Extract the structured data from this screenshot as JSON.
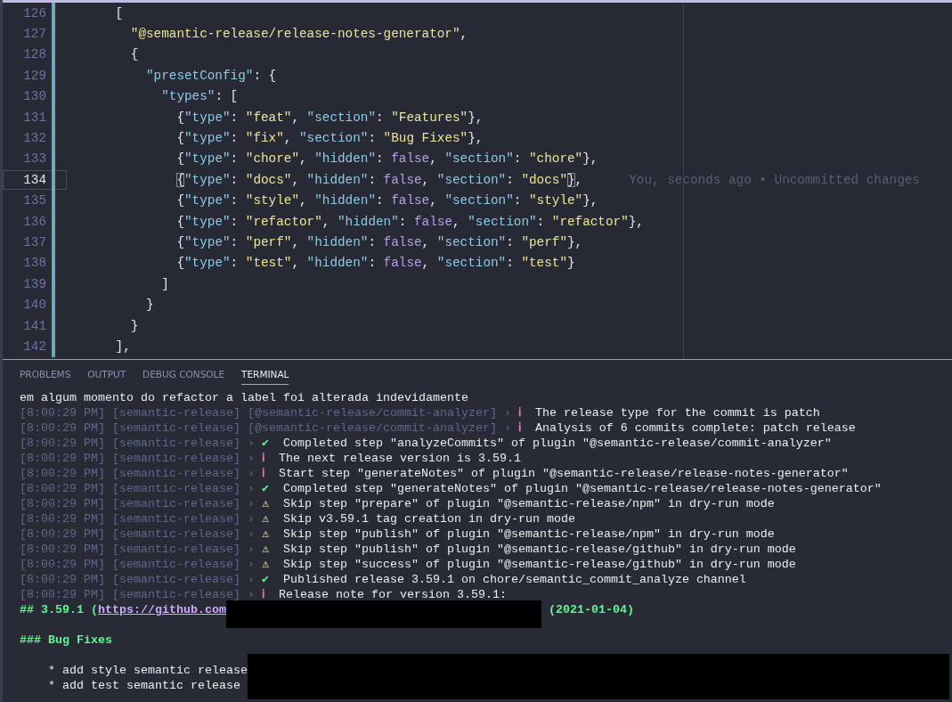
{
  "editor": {
    "lines": [
      {
        "number": "126",
        "modified": true,
        "current": false,
        "tokens": [
          {
            "kind": "punct",
            "text": "      ["
          }
        ]
      },
      {
        "number": "127",
        "modified": true,
        "current": false,
        "tokens": [
          {
            "kind": "str",
            "text": "        \"@semantic-release/release-notes-generator\""
          },
          {
            "kind": "punct",
            "text": ","
          }
        ]
      },
      {
        "number": "128",
        "modified": true,
        "current": false,
        "tokens": [
          {
            "kind": "punct",
            "text": "        {"
          }
        ]
      },
      {
        "number": "129",
        "modified": true,
        "current": false,
        "tokens": [
          {
            "kind": "key",
            "text": "          \"presetConfig\""
          },
          {
            "kind": "punct",
            "text": ": {"
          }
        ]
      },
      {
        "number": "130",
        "modified": true,
        "current": false,
        "tokens": [
          {
            "kind": "key",
            "text": "            \"types\""
          },
          {
            "kind": "punct",
            "text": ": ["
          }
        ]
      },
      {
        "number": "131",
        "modified": true,
        "current": false,
        "tokens": [
          {
            "kind": "punct",
            "text": "              {"
          },
          {
            "kind": "key",
            "text": "\"type\""
          },
          {
            "kind": "punct",
            "text": ": "
          },
          {
            "kind": "str",
            "text": "\"feat\""
          },
          {
            "kind": "punct",
            "text": ", "
          },
          {
            "kind": "key",
            "text": "\"section\""
          },
          {
            "kind": "punct",
            "text": ": "
          },
          {
            "kind": "str",
            "text": "\"Features\""
          },
          {
            "kind": "punct",
            "text": "},"
          }
        ]
      },
      {
        "number": "132",
        "modified": true,
        "current": false,
        "tokens": [
          {
            "kind": "punct",
            "text": "              {"
          },
          {
            "kind": "key",
            "text": "\"type\""
          },
          {
            "kind": "punct",
            "text": ": "
          },
          {
            "kind": "str",
            "text": "\"fix\""
          },
          {
            "kind": "punct",
            "text": ", "
          },
          {
            "kind": "key",
            "text": "\"section\""
          },
          {
            "kind": "punct",
            "text": ": "
          },
          {
            "kind": "str",
            "text": "\"Bug Fixes\""
          },
          {
            "kind": "punct",
            "text": "},"
          }
        ]
      },
      {
        "number": "133",
        "modified": true,
        "current": false,
        "tokens": [
          {
            "kind": "punct",
            "text": "              {"
          },
          {
            "kind": "key",
            "text": "\"type\""
          },
          {
            "kind": "punct",
            "text": ": "
          },
          {
            "kind": "str",
            "text": "\"chore\""
          },
          {
            "kind": "punct",
            "text": ", "
          },
          {
            "kind": "key",
            "text": "\"hidden\""
          },
          {
            "kind": "punct",
            "text": ": "
          },
          {
            "kind": "bool",
            "text": "false"
          },
          {
            "kind": "punct",
            "text": ", "
          },
          {
            "kind": "key",
            "text": "\"section\""
          },
          {
            "kind": "punct",
            "text": ": "
          },
          {
            "kind": "str",
            "text": "\"chore\""
          },
          {
            "kind": "punct",
            "text": "},"
          }
        ]
      },
      {
        "number": "134",
        "modified": true,
        "current": true,
        "annotation": "You, seconds ago • Uncommitted changes",
        "tokens": [
          {
            "kind": "bracket",
            "text": "              {"
          },
          {
            "kind": "key",
            "text": "\"type\""
          },
          {
            "kind": "punct",
            "text": ": "
          },
          {
            "kind": "str",
            "text": "\"docs\""
          },
          {
            "kind": "punct",
            "text": ", "
          },
          {
            "kind": "key",
            "text": "\"hidden\""
          },
          {
            "kind": "punct",
            "text": ": "
          },
          {
            "kind": "bool",
            "text": "false"
          },
          {
            "kind": "punct",
            "text": ", "
          },
          {
            "kind": "key",
            "text": "\"section\""
          },
          {
            "kind": "punct",
            "text": ": "
          },
          {
            "kind": "str",
            "text": "\"docs\""
          },
          {
            "kind": "bracket",
            "text": "}"
          },
          {
            "kind": "punct",
            "text": ","
          }
        ]
      },
      {
        "number": "135",
        "modified": true,
        "current": false,
        "tokens": [
          {
            "kind": "punct",
            "text": "              {"
          },
          {
            "kind": "key",
            "text": "\"type\""
          },
          {
            "kind": "punct",
            "text": ": "
          },
          {
            "kind": "str",
            "text": "\"style\""
          },
          {
            "kind": "punct",
            "text": ", "
          },
          {
            "kind": "key",
            "text": "\"hidden\""
          },
          {
            "kind": "punct",
            "text": ": "
          },
          {
            "kind": "bool",
            "text": "false"
          },
          {
            "kind": "punct",
            "text": ", "
          },
          {
            "kind": "key",
            "text": "\"section\""
          },
          {
            "kind": "punct",
            "text": ": "
          },
          {
            "kind": "str",
            "text": "\"style\""
          },
          {
            "kind": "punct",
            "text": "},"
          }
        ]
      },
      {
        "number": "136",
        "modified": true,
        "current": false,
        "tokens": [
          {
            "kind": "punct",
            "text": "              {"
          },
          {
            "kind": "key",
            "text": "\"type\""
          },
          {
            "kind": "punct",
            "text": ": "
          },
          {
            "kind": "str",
            "text": "\"refactor\""
          },
          {
            "kind": "punct",
            "text": ", "
          },
          {
            "kind": "key",
            "text": "\"hidden\""
          },
          {
            "kind": "punct",
            "text": ": "
          },
          {
            "kind": "bool",
            "text": "false"
          },
          {
            "kind": "punct",
            "text": ", "
          },
          {
            "kind": "key",
            "text": "\"section\""
          },
          {
            "kind": "punct",
            "text": ": "
          },
          {
            "kind": "str",
            "text": "\"refactor\""
          },
          {
            "kind": "punct",
            "text": "},"
          }
        ]
      },
      {
        "number": "137",
        "modified": true,
        "current": false,
        "tokens": [
          {
            "kind": "punct",
            "text": "              {"
          },
          {
            "kind": "key",
            "text": "\"type\""
          },
          {
            "kind": "punct",
            "text": ": "
          },
          {
            "kind": "str",
            "text": "\"perf\""
          },
          {
            "kind": "punct",
            "text": ", "
          },
          {
            "kind": "key",
            "text": "\"hidden\""
          },
          {
            "kind": "punct",
            "text": ": "
          },
          {
            "kind": "bool",
            "text": "false"
          },
          {
            "kind": "punct",
            "text": ", "
          },
          {
            "kind": "key",
            "text": "\"section\""
          },
          {
            "kind": "punct",
            "text": ": "
          },
          {
            "kind": "str",
            "text": "\"perf\""
          },
          {
            "kind": "punct",
            "text": "},"
          }
        ]
      },
      {
        "number": "138",
        "modified": true,
        "current": false,
        "tokens": [
          {
            "kind": "punct",
            "text": "              {"
          },
          {
            "kind": "key",
            "text": "\"type\""
          },
          {
            "kind": "punct",
            "text": ": "
          },
          {
            "kind": "str",
            "text": "\"test\""
          },
          {
            "kind": "punct",
            "text": ", "
          },
          {
            "kind": "key",
            "text": "\"hidden\""
          },
          {
            "kind": "punct",
            "text": ": "
          },
          {
            "kind": "bool",
            "text": "false"
          },
          {
            "kind": "punct",
            "text": ", "
          },
          {
            "kind": "key",
            "text": "\"section\""
          },
          {
            "kind": "punct",
            "text": ": "
          },
          {
            "kind": "str",
            "text": "\"test\""
          },
          {
            "kind": "punct",
            "text": "}"
          }
        ]
      },
      {
        "number": "139",
        "modified": true,
        "current": false,
        "tokens": [
          {
            "kind": "punct",
            "text": "            ]"
          }
        ]
      },
      {
        "number": "140",
        "modified": true,
        "current": false,
        "tokens": [
          {
            "kind": "punct",
            "text": "          }"
          }
        ]
      },
      {
        "number": "141",
        "modified": true,
        "current": false,
        "tokens": [
          {
            "kind": "punct",
            "text": "        }"
          }
        ]
      },
      {
        "number": "142",
        "modified": true,
        "current": false,
        "tokens": [
          {
            "kind": "punct",
            "text": "      ],"
          }
        ]
      }
    ]
  },
  "panel": {
    "tabs": [
      {
        "label": "PROBLEMS",
        "selected": false
      },
      {
        "label": "OUTPUT",
        "selected": false
      },
      {
        "label": "DEBUG CONSOLE",
        "selected": false
      },
      {
        "label": "TERMINAL",
        "selected": true
      }
    ],
    "terminal": {
      "lines": [
        {
          "kind": "plain",
          "text": "em algum momento do refactor a label foi alterada indevidamente"
        },
        {
          "kind": "log",
          "time": "[8:00:29 PM]",
          "scope": "[semantic-release]",
          "plugin": "[@semantic-release/commit-analyzer]",
          "sep": "›",
          "icon": {
            "kind": "info",
            "glyph": "ℹ"
          },
          "message": "The release type for the commit is patch"
        },
        {
          "kind": "log",
          "time": "[8:00:29 PM]",
          "scope": "[semantic-release]",
          "plugin": "[@semantic-release/commit-analyzer]",
          "sep": "›",
          "icon": {
            "kind": "info",
            "glyph": "ℹ"
          },
          "message": "Analysis of 6 commits complete: patch release"
        },
        {
          "kind": "log",
          "time": "[8:00:29 PM]",
          "scope": "[semantic-release]",
          "sep": "›",
          "icon": {
            "kind": "success",
            "glyph": "✔"
          },
          "message": "Completed step \"analyzeCommits\" of plugin \"@semantic-release/commit-analyzer\""
        },
        {
          "kind": "log",
          "time": "[8:00:29 PM]",
          "scope": "[semantic-release]",
          "sep": "›",
          "icon": {
            "kind": "info",
            "glyph": "ℹ"
          },
          "message": "The next release version is 3.59.1"
        },
        {
          "kind": "log",
          "time": "[8:00:29 PM]",
          "scope": "[semantic-release]",
          "sep": "›",
          "icon": {
            "kind": "info",
            "glyph": "ℹ"
          },
          "message": "Start step \"generateNotes\" of plugin \"@semantic-release/release-notes-generator\""
        },
        {
          "kind": "log",
          "time": "[8:00:29 PM]",
          "scope": "[semantic-release]",
          "sep": "›",
          "icon": {
            "kind": "success",
            "glyph": "✔"
          },
          "message": "Completed step \"generateNotes\" of plugin \"@semantic-release/release-notes-generator\""
        },
        {
          "kind": "log",
          "time": "[8:00:29 PM]",
          "scope": "[semantic-release]",
          "sep": "›",
          "icon": {
            "kind": "warn",
            "glyph": "⚠"
          },
          "message": "Skip step \"prepare\" of plugin \"@semantic-release/npm\" in dry-run mode"
        },
        {
          "kind": "log",
          "time": "[8:00:29 PM]",
          "scope": "[semantic-release]",
          "sep": "›",
          "icon": {
            "kind": "warn",
            "glyph": "⚠"
          },
          "message": "Skip v3.59.1 tag creation in dry-run mode"
        },
        {
          "kind": "log",
          "time": "[8:00:29 PM]",
          "scope": "[semantic-release]",
          "sep": "›",
          "icon": {
            "kind": "warn",
            "glyph": "⚠"
          },
          "message": "Skip step \"publish\" of plugin \"@semantic-release/npm\" in dry-run mode"
        },
        {
          "kind": "log",
          "time": "[8:00:29 PM]",
          "scope": "[semantic-release]",
          "sep": "›",
          "icon": {
            "kind": "warn",
            "glyph": "⚠"
          },
          "message": "Skip step \"publish\" of plugin \"@semantic-release/github\" in dry-run mode"
        },
        {
          "kind": "log",
          "time": "[8:00:29 PM]",
          "scope": "[semantic-release]",
          "sep": "›",
          "icon": {
            "kind": "warn",
            "glyph": "⚠"
          },
          "message": "Skip step \"success\" of plugin \"@semantic-release/github\" in dry-run mode"
        },
        {
          "kind": "log",
          "time": "[8:00:29 PM]",
          "scope": "[semantic-release]",
          "sep": "›",
          "icon": {
            "kind": "success",
            "glyph": "✔"
          },
          "message": "Published release 3.59.1 on chore/semantic_commit_analyze channel"
        },
        {
          "kind": "log",
          "time": "[8:00:29 PM]",
          "scope": "[semantic-release]",
          "sep": "›",
          "icon": {
            "kind": "info",
            "glyph": "ℹ"
          },
          "message": "Release note for version 3.59.1:"
        }
      ],
      "release_heading": {
        "prefix": "## 3.59.1 (",
        "link": "https://github.com",
        "redacted": true,
        "suffix": "(2021-01-04)"
      },
      "section_heading": "### Bug Fixes",
      "bullets": {
        "redacted": true,
        "items": [
          "* add style semantic release",
          "* add test semantic release"
        ]
      }
    }
  }
}
